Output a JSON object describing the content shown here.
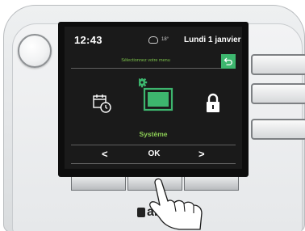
{
  "status_bar": {
    "time": "12:43",
    "temperature": "18°",
    "date": "Lundi 1 janvier"
  },
  "menu": {
    "title": "Sélectionnez votre menu",
    "back_icon": "back-arrow-icon",
    "items": [
      {
        "icon": "calendar-clock-icon"
      },
      {
        "icon": "gear-screen-icon",
        "label": "Système",
        "selected": true
      },
      {
        "icon": "lock-icon"
      }
    ]
  },
  "nav": {
    "prev": "<",
    "ok": "OK",
    "next": ">"
  },
  "brand": {
    "logo_text": "alo"
  },
  "colors": {
    "accent_green": "#3db66e",
    "selected_text": "#8ccc55",
    "screen_bg": "#1a1a1a"
  }
}
